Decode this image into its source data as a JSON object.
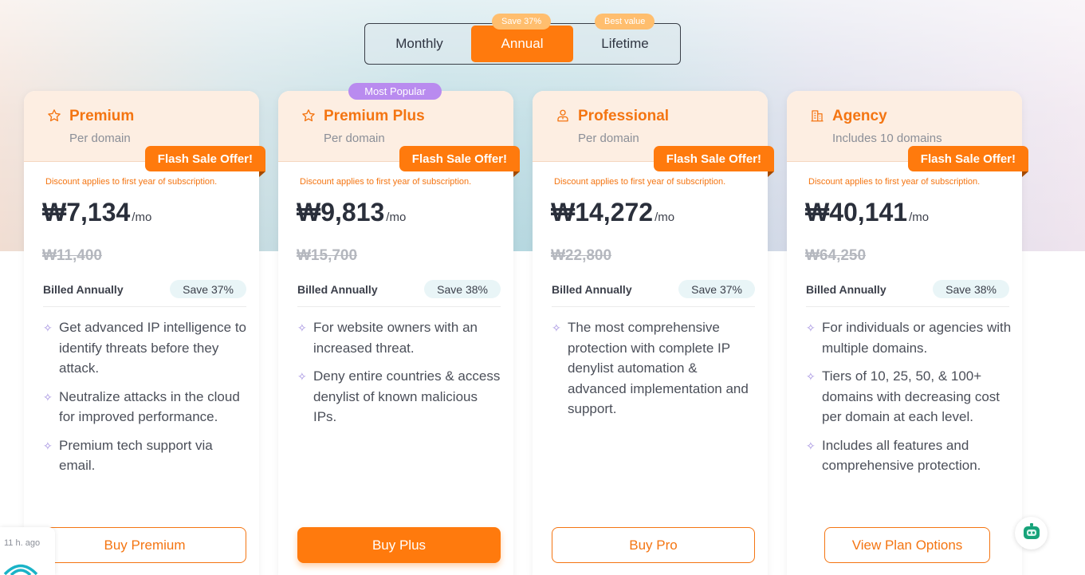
{
  "billing_toggle": {
    "monthly": "Monthly",
    "annual": "Annual",
    "lifetime": "Lifetime",
    "annual_badge": "Save 37%",
    "lifetime_badge": "Best value",
    "selected": "Annual"
  },
  "popular_badge": "Most Popular",
  "colors": {
    "accent": "#ff7a0d",
    "popular": "#b98bef",
    "header_bg": "#fdeee2"
  },
  "plans": [
    {
      "icon": "star-icon",
      "name": "Premium",
      "subtitle": "Per domain",
      "flash": "Flash Sale Offer!",
      "discount_note": "Discount applies to first year of subscription.",
      "price": "₩7,134",
      "per": "/mo",
      "old_price": "₩11,400",
      "billed": "Billed Annually",
      "save": "Save 37%",
      "features": [
        "Get advanced IP intelligence to identify threats before they attack.",
        "Neutralize attacks in the cloud for improved performance.",
        "Premium tech support via email."
      ],
      "cta": "Buy Premium"
    },
    {
      "icon": "star-icon",
      "name": "Premium Plus",
      "subtitle": "Per domain",
      "flash": "Flash Sale Offer!",
      "discount_note": "Discount applies to first year of subscription.",
      "price": "₩9,813",
      "per": "/mo",
      "old_price": "₩15,700",
      "billed": "Billed Annually",
      "save": "Save 38%",
      "features": [
        "For website owners with an increased threat.",
        "Deny entire countries & access denylist of known malicious IPs."
      ],
      "cta": "Buy Plus"
    },
    {
      "icon": "person-icon",
      "name": "Professional",
      "subtitle": "Per domain",
      "flash": "Flash Sale Offer!",
      "discount_note": "Discount applies to first year of subscription.",
      "price": "₩14,272",
      "per": "/mo",
      "old_price": "₩22,800",
      "billed": "Billed Annually",
      "save": "Save 37%",
      "features": [
        "The most comprehensive protection with complete IP denylist automation & advanced implementation and support."
      ],
      "cta": "Buy Pro"
    },
    {
      "icon": "building-icon",
      "name": "Agency",
      "subtitle": "Includes 10 domains",
      "flash": "Flash Sale Offer!",
      "discount_note": "Discount applies to first year of subscription.",
      "price": "₩40,141",
      "per": "/mo",
      "old_price": "₩64,250",
      "billed": "Billed Annually",
      "save": "Save 38%",
      "features": [
        "For individuals or agencies with multiple domains.",
        "Tiers of 10, 25, 50, & 100+ domains with decreasing cost per domain at each level.",
        "Includes all features and comprehensive protection."
      ],
      "cta": "View Plan Options"
    }
  ],
  "chat_widget": {
    "time": "11 h. ago",
    "icon": "wifi-icon"
  },
  "help_button": {
    "icon": "robot-icon"
  }
}
